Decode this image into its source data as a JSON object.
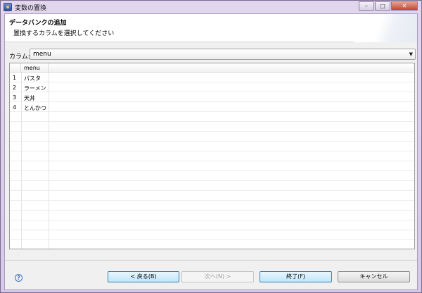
{
  "window": {
    "title": "変数の置換"
  },
  "banner": {
    "title": "データバンクの追加",
    "description": "置換するカラムを選択してください"
  },
  "column_selector": {
    "label": "カラム:",
    "value": "menu"
  },
  "table": {
    "header": "menu",
    "rows": [
      {
        "index": "1",
        "value": "パスタ"
      },
      {
        "index": "2",
        "value": "ラーメン"
      },
      {
        "index": "3",
        "value": "天丼"
      },
      {
        "index": "4",
        "value": "とんかつ"
      }
    ]
  },
  "buttons": {
    "back": "< 戻る(B)",
    "next": "次へ(N) >",
    "finish": "終了(F)",
    "cancel": "キャンセル"
  },
  "help_icon": "?"
}
